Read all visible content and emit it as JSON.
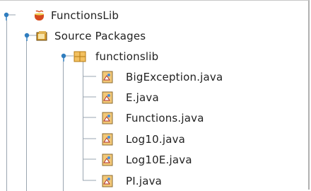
{
  "tree": {
    "project": {
      "label": "FunctionsLib",
      "icon": "coffee-cup-icon",
      "expanded": true
    },
    "source_packages": {
      "label": "Source Packages",
      "icon": "source-folder-icon",
      "expanded": true
    },
    "package": {
      "label": "functionslib",
      "icon": "package-icon",
      "expanded": true
    },
    "files": [
      {
        "label": "BigException.java",
        "icon": "java-file-icon"
      },
      {
        "label": "E.java",
        "icon": "java-file-icon"
      },
      {
        "label": "Functions.java",
        "icon": "java-file-icon"
      },
      {
        "label": "Log10.java",
        "icon": "java-file-icon"
      },
      {
        "label": "Log10E.java",
        "icon": "java-file-icon"
      },
      {
        "label": "PI.java",
        "icon": "java-file-icon"
      }
    ]
  },
  "colors": {
    "guide": "#9aa5b0",
    "toggle": "#2f7dbf",
    "text": "#222222",
    "package": "#e3a32c",
    "file": "#f2c877"
  }
}
